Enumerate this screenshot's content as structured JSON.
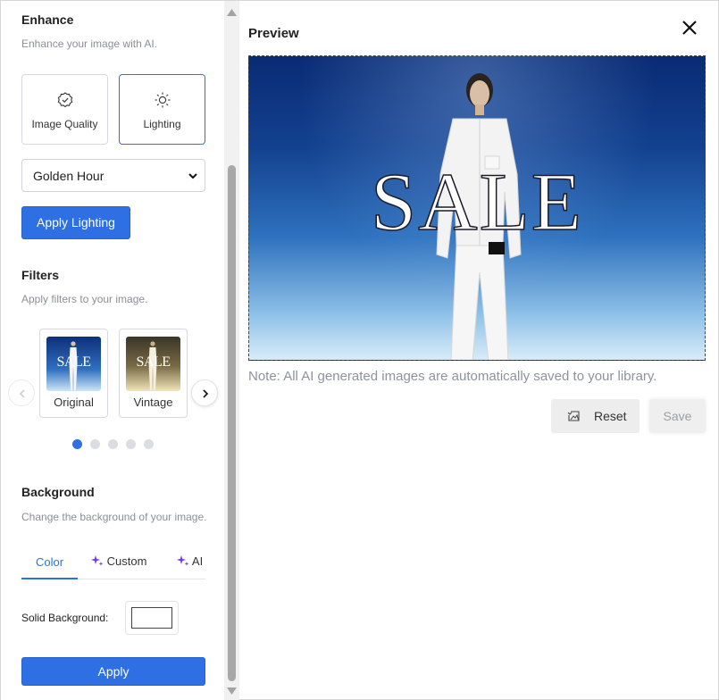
{
  "enhance": {
    "title": "Enhance",
    "subtitle": "Enhance your image with AI.",
    "options": [
      {
        "label": "Image Quality",
        "icon": "badge-check-icon"
      },
      {
        "label": "Lighting",
        "icon": "sun-icon"
      }
    ],
    "selected_option": "Lighting",
    "lighting_select": {
      "value": "Golden Hour"
    },
    "apply_label": "Apply Lighting"
  },
  "filters": {
    "title": "Filters",
    "subtitle": "Apply filters to your image.",
    "items": [
      {
        "label": "Original",
        "thumb_text": "SALE"
      },
      {
        "label": "Vintage",
        "thumb_text": "SALE"
      }
    ],
    "page_count": 5,
    "active_page": 1
  },
  "background": {
    "title": "Background",
    "subtitle": "Change the background of your image.",
    "tabs": [
      {
        "label": "Color"
      },
      {
        "label": "Custom"
      },
      {
        "label": "AI"
      }
    ],
    "active_tab": "Color",
    "solid_label": "Solid Background:",
    "solid_color": "#ffffff",
    "apply_label": "Apply"
  },
  "preview": {
    "title": "Preview",
    "image_text": "SALE",
    "note": "Note: All AI generated images are automatically saved to your library.",
    "reset_label": "Reset",
    "save_label": "Save"
  },
  "colors": {
    "accent": "#2f6fe4",
    "ai_sparkle": "#7b3fe4"
  }
}
